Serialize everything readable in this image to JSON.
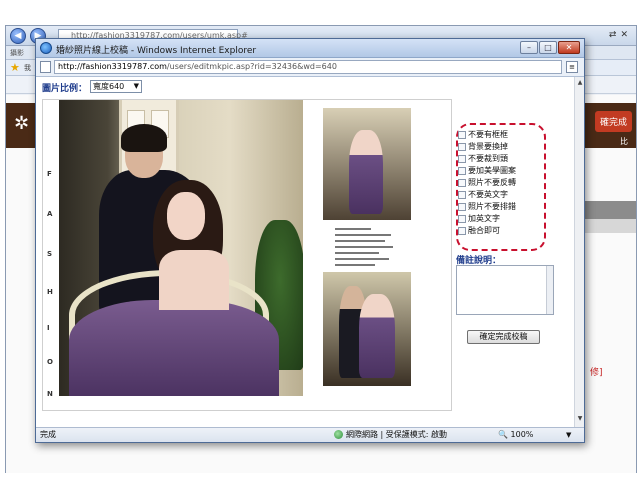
{
  "background": {
    "url": "http://fashion3319787.com/users/umk.asp#",
    "tab_text": "攝影",
    "favorites_text": "我",
    "finish_button": "確完成",
    "side_text": "比",
    "red_link": "修]"
  },
  "popup": {
    "title": "婚紗照片線上校稿 - Windows Internet Explorer",
    "url_host": "http://fashion3319787.com",
    "url_path": "/users/editmkpic.asp?rid=32436&wd=640",
    "ratio_label": "圖片比例：",
    "ratio_value": "寬度640",
    "fashion_letters": [
      "F",
      "A",
      "S",
      "H",
      "I",
      "O",
      "N"
    ],
    "options": [
      "不要有框框",
      "背景要換掉",
      "不要裁到頭",
      "要加美學圖案",
      "照片不要反轉",
      "不要英文字",
      "照片不要排錯",
      "加英文字",
      "融合即可"
    ],
    "remark_label": "備註說明：",
    "confirm_button": "確定完成校稿",
    "status_done": "完成",
    "status_zone": "網際網路 | 受保護模式: 啟動",
    "zoom": "100%"
  }
}
